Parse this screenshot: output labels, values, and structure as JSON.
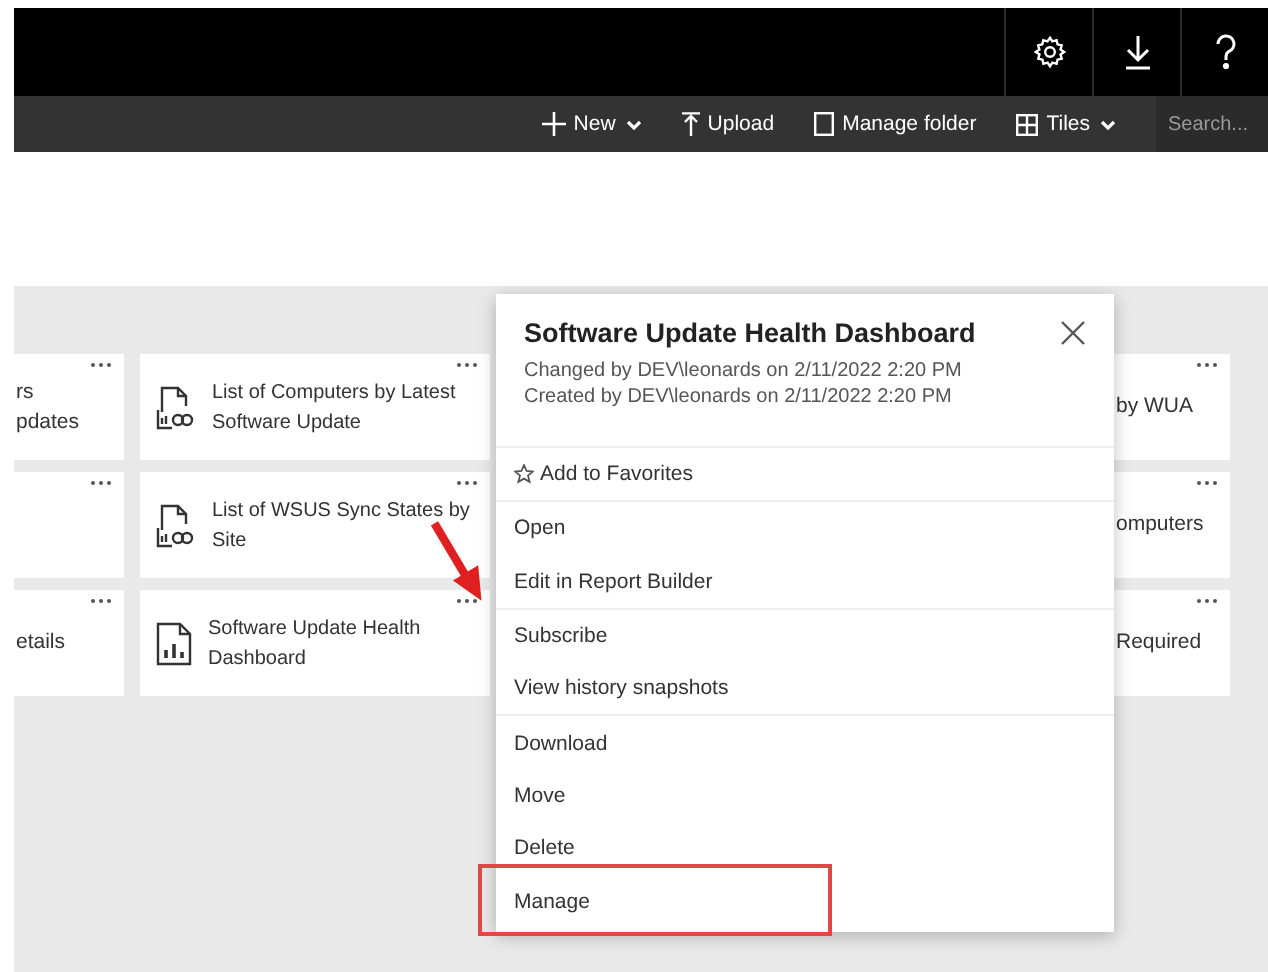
{
  "header": {
    "buttons": [
      {
        "kind": "settings"
      },
      {
        "kind": "download"
      },
      {
        "kind": "help"
      }
    ]
  },
  "toolbar": {
    "items": [
      {
        "kind": "new",
        "label": "New"
      },
      {
        "kind": "upload",
        "label": "Upload"
      },
      {
        "kind": "folder",
        "label": "Manage folder"
      },
      {
        "kind": "tiles",
        "label": "Tiles"
      }
    ],
    "search": {
      "placeholder": "Search..."
    }
  },
  "tiles": [
    {
      "kind": "cut_left",
      "text": "rs\npdates"
    },
    {
      "kind": "report",
      "text": "List of Computers by Latest Software Update"
    },
    {
      "kind": "cut_right",
      "text": "by WUA"
    },
    {
      "kind": "cut_left_blank"
    },
    {
      "kind": "report",
      "text": "List of WSUS Sync States by Site"
    },
    {
      "kind": "cut_right",
      "text": "omputers"
    },
    {
      "kind": "cut_left",
      "text": "etails"
    },
    {
      "kind": "dashboard",
      "text": "Software Update Health Dashboard"
    },
    {
      "kind": "cut_right",
      "text": "Required"
    }
  ],
  "menu": {
    "title": "Software Update Health Dashboard",
    "details": [
      "Changed by DEV\\leonards on 2/11/2022 2:20 PM",
      "Created by DEV\\leonards on 2/11/2022 2:20 PM"
    ],
    "groups": [
      [
        {
          "label": "Add to Favorites",
          "kind": "favorite",
          "highlighted": false
        }
      ],
      [
        {
          "label": "Open",
          "kind": "plain",
          "highlighted": false
        },
        {
          "label": "Edit in Report Builder",
          "kind": "plain",
          "highlighted": false
        }
      ],
      [
        {
          "label": "Subscribe",
          "kind": "plain",
          "highlighted": false
        },
        {
          "label": "View history snapshots",
          "kind": "plain",
          "highlighted": false
        }
      ],
      [
        {
          "label": "Download",
          "kind": "plain",
          "highlighted": false
        },
        {
          "label": "Move",
          "kind": "plain",
          "highlighted": false
        },
        {
          "label": "Delete",
          "kind": "plain",
          "highlighted": false
        },
        {
          "label": "Manage",
          "kind": "plain",
          "highlighted": true
        }
      ]
    ]
  }
}
